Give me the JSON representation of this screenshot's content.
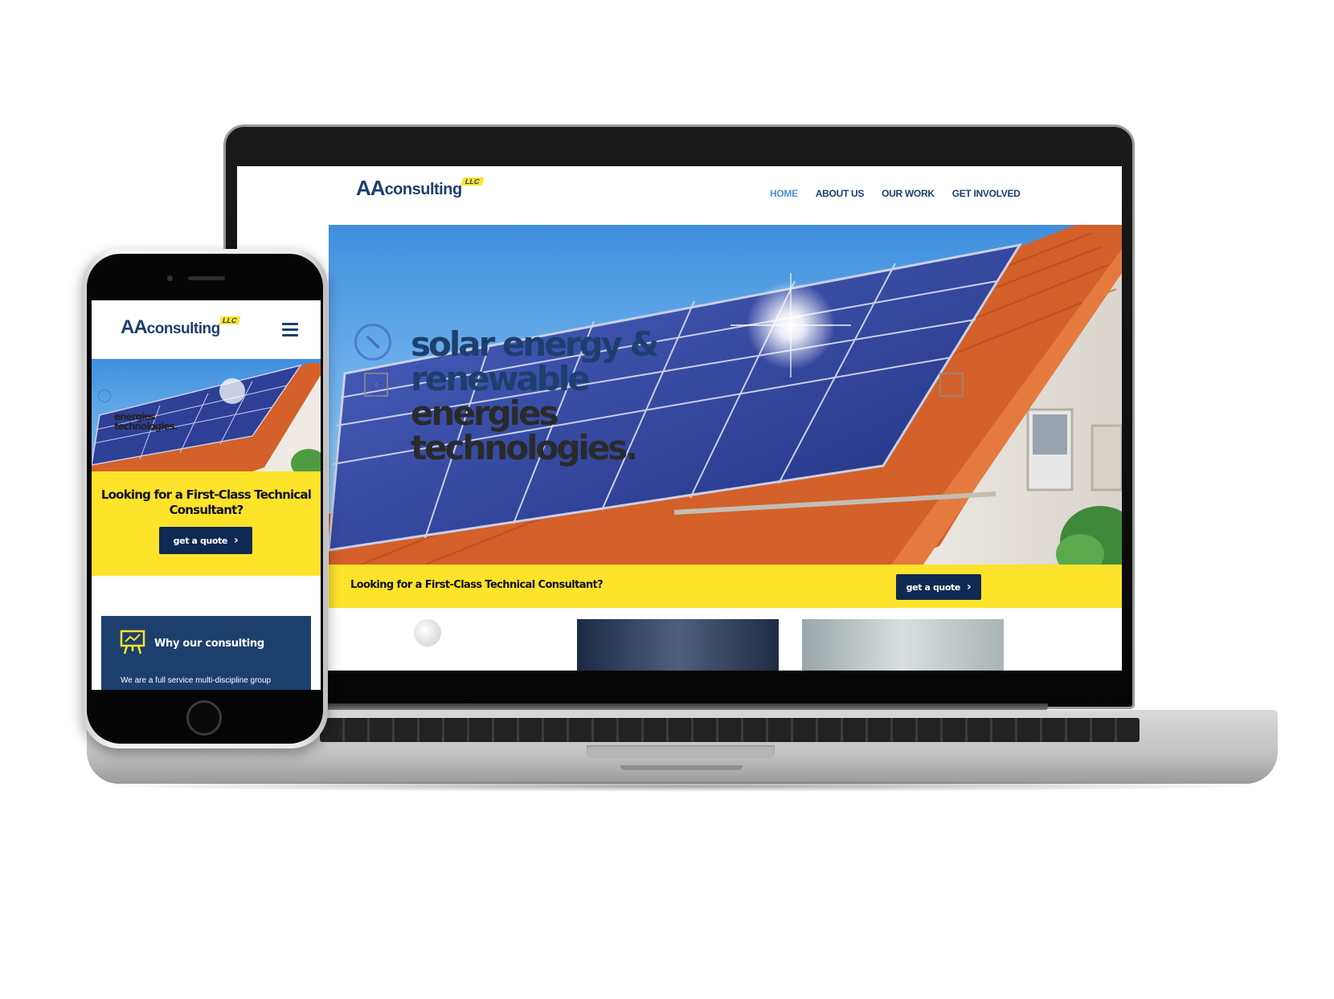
{
  "brand": {
    "logo_aa": "AA",
    "logo_consulting": "consulting",
    "logo_llc": "LLC"
  },
  "desktop": {
    "nav": [
      {
        "label": "HOME",
        "active": true
      },
      {
        "label": "ABOUT US",
        "active": false
      },
      {
        "label": "OUR WORK",
        "active": false
      },
      {
        "label": "GET INVOLVED",
        "active": false
      }
    ],
    "hero": {
      "line1": "solar energy &",
      "line2": "renewable",
      "line3": "energies",
      "line4": "technologies.",
      "prev_icon": "chevron-left-icon",
      "next_icon": "chevron-right-icon",
      "badge_icon": "compass-icon"
    },
    "cta": {
      "text": "Looking for a First-Class Technical Consultant?",
      "button_label": "get a quote"
    }
  },
  "mobile": {
    "menu_icon": "hamburger-menu-icon",
    "hero": {
      "line3": "energies",
      "line4": "technologies."
    },
    "cta": {
      "text": "Looking for a First-Class Technical Consultant?",
      "button_label": "get a quote"
    },
    "card": {
      "icon": "presentation-board-icon",
      "title": "Why our consulting",
      "body": "We are a full service multi-discipline group"
    }
  },
  "colors": {
    "navy": "#1d3f6e",
    "dark_navy": "#0f2a52",
    "accent_yellow": "#fde32a",
    "nav_active": "#4a90d9"
  }
}
